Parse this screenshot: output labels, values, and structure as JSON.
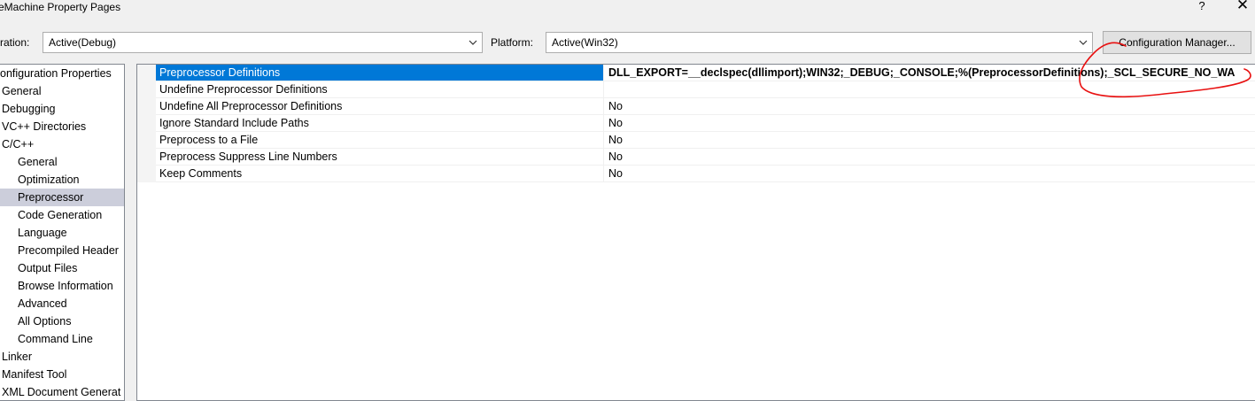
{
  "window": {
    "title": "eMachine Property Pages",
    "help_label": "?",
    "close_label": "✕"
  },
  "toolbar": {
    "configuration_label": "ration:",
    "configuration_value": "Active(Debug)",
    "platform_label": "Platform:",
    "platform_value": "Active(Win32)",
    "config_manager_label": "Configuration Manager..."
  },
  "tree": {
    "items": [
      {
        "label": "onfiguration Properties",
        "selected": false
      },
      {
        "label": "General",
        "selected": false
      },
      {
        "label": "Debugging",
        "selected": false
      },
      {
        "label": "VC++ Directories",
        "selected": false
      },
      {
        "label": "C/C++",
        "selected": false
      },
      {
        "label": "General",
        "selected": false
      },
      {
        "label": "Optimization",
        "selected": false
      },
      {
        "label": "Preprocessor",
        "selected": true
      },
      {
        "label": "Code Generation",
        "selected": false
      },
      {
        "label": "Language",
        "selected": false
      },
      {
        "label": "Precompiled Header",
        "selected": false
      },
      {
        "label": "Output Files",
        "selected": false
      },
      {
        "label": "Browse Information",
        "selected": false
      },
      {
        "label": "Advanced",
        "selected": false
      },
      {
        "label": "All Options",
        "selected": false
      },
      {
        "label": "Command Line",
        "selected": false
      },
      {
        "label": "Linker",
        "selected": false
      },
      {
        "label": "Manifest Tool",
        "selected": false
      },
      {
        "label": "XML Document Generat",
        "selected": false
      }
    ]
  },
  "properties": {
    "rows": [
      {
        "name": "Preprocessor Definitions",
        "value": "DLL_EXPORT=__declspec(dllimport);WIN32;_DEBUG;_CONSOLE;%(PreprocessorDefinitions);_SCL_SECURE_NO_WARNINGS"
      },
      {
        "name": "Undefine Preprocessor Definitions",
        "value": ""
      },
      {
        "name": "Undefine All Preprocessor Definitions",
        "value": "No"
      },
      {
        "name": "Ignore Standard Include Paths",
        "value": "No"
      },
      {
        "name": "Preprocess to a File",
        "value": "No"
      },
      {
        "name": "Preprocess Suppress Line Numbers",
        "value": "No"
      },
      {
        "name": "Keep Comments",
        "value": "No"
      }
    ]
  },
  "colors": {
    "selection_accent": "#0078d7",
    "tree_selection": "#cccedb",
    "annotation": "#e81010"
  }
}
